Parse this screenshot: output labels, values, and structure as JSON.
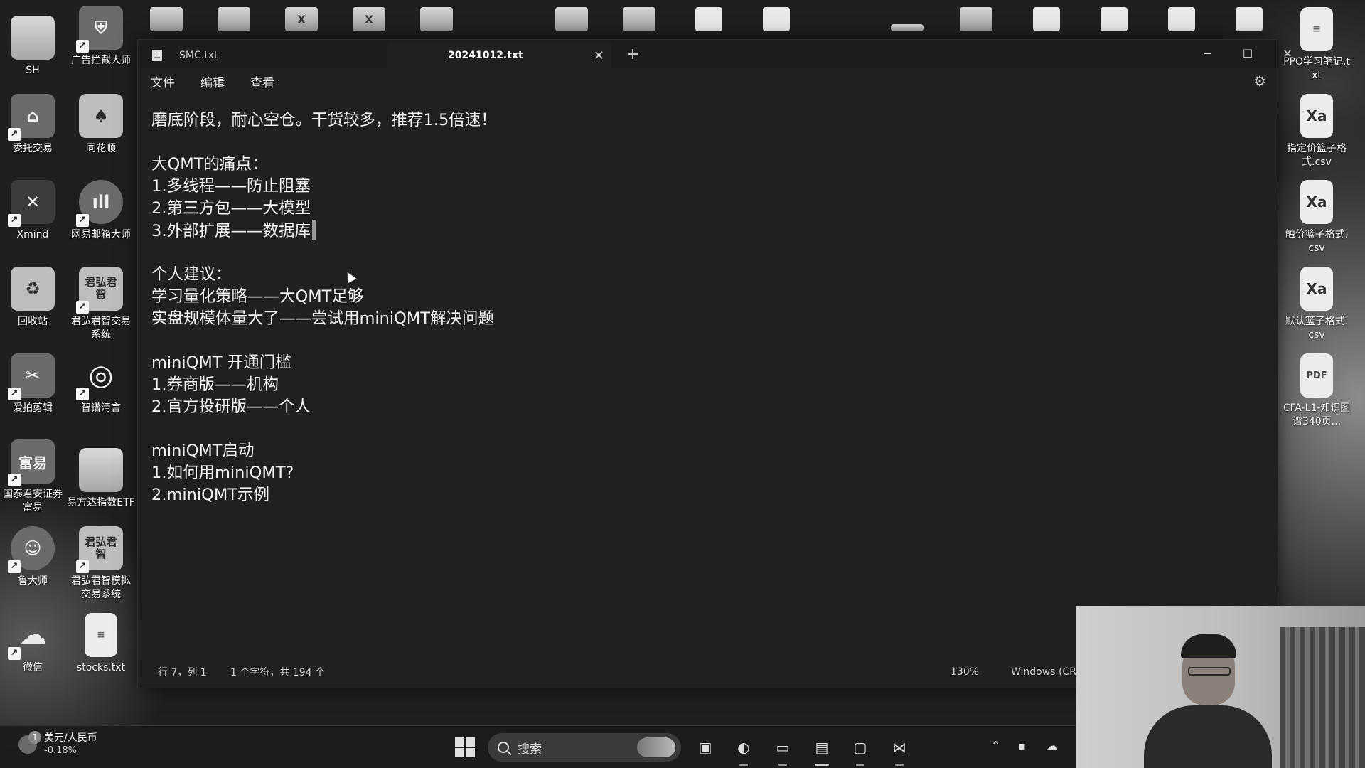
{
  "desktop": {
    "left_icons": [
      {
        "id": "sh",
        "label": "SH",
        "icon": "folder-icon"
      },
      {
        "id": "ad-blocker",
        "label": "广告拦截大师",
        "icon": "shield-icon"
      },
      {
        "id": "trade-delegate",
        "label": "委托交易",
        "icon": "house-icon"
      },
      {
        "id": "tonghuashun",
        "label": "同花顺",
        "icon": "fan-icon"
      },
      {
        "id": "xmind",
        "label": "Xmind",
        "icon": "xmind-icon"
      },
      {
        "id": "netease-mail",
        "label": "网易邮箱大师",
        "icon": "mail-icon"
      },
      {
        "id": "recycle-bin",
        "label": "回收站",
        "icon": "recycle-icon"
      },
      {
        "id": "junhong-trade",
        "label": "君弘君智交易系统",
        "icon": "junhong-icon",
        "glyph_text": "君弘君智"
      },
      {
        "id": "aipai-editor",
        "label": "爱拍剪辑",
        "icon": "scissors-icon"
      },
      {
        "id": "zhipu-qingyan",
        "label": "智谱清言",
        "icon": "spiral-icon"
      },
      {
        "id": "fuyi",
        "label": "国泰君安证券富易",
        "icon": "fuyi-icon",
        "glyph_text": "富易"
      },
      {
        "id": "efund-etf",
        "label": "易方达指数ETF",
        "icon": "folder-icon"
      },
      {
        "id": "ludashi",
        "label": "鲁大师",
        "icon": "ludashi-icon"
      },
      {
        "id": "junhong-sim",
        "label": "君弘君智模拟交易系统",
        "icon": "junhong-icon",
        "glyph_text": "君弘君智"
      },
      {
        "id": "wechat",
        "label": "微信",
        "icon": "wechat-icon"
      },
      {
        "id": "stocks-txt",
        "label": "stocks.txt",
        "icon": "text-file-icon"
      }
    ],
    "right_icons": [
      {
        "id": "ppo-notes",
        "label": "PPO学习笔记.txt",
        "icon": "text-file-icon"
      },
      {
        "id": "limit-basket",
        "label": "指定价篮子格式.csv",
        "icon": "excel-csv-icon"
      },
      {
        "id": "trigger-basket",
        "label": "触价篮子格式.csv",
        "icon": "excel-csv-icon"
      },
      {
        "id": "default-basket",
        "label": "默认篮子格式.csv",
        "icon": "excel-csv-icon"
      },
      {
        "id": "cfa-pdf",
        "label": "CFA-L1-知识图谱340页...",
        "icon": "pdf-icon",
        "glyph_text": "PDF"
      }
    ]
  },
  "notepad": {
    "tabs": [
      {
        "title": "SMC.txt",
        "active": false
      },
      {
        "title": "20241012.txt",
        "active": true
      }
    ],
    "menu": [
      "文件",
      "编辑",
      "查看"
    ],
    "content_lines": [
      "磨底阶段，耐心空仓。干货较多，推荐1.5倍速！",
      "",
      "大QMT的痛点：",
      "1.多线程——防止阻塞",
      "2.第三方包——大模型",
      "3.外部扩展——数据库",
      "",
      "个人建议：",
      "学习量化策略——大QMT足够",
      "实盘规模体量大了——尝试用miniQMT解决问题",
      "",
      "miniQMT 开通门槛",
      "1.券商版——机构",
      "2.官方投研版——个人",
      "",
      "miniQMT启动",
      "1.如何用miniQMT?",
      "2.miniQMT示例"
    ],
    "status": {
      "position": "行 7，列 1",
      "char_count": "1 个字符，共 194 个",
      "zoom": "130%",
      "line_ending": "Windows (CR"
    }
  },
  "taskbar": {
    "widget": {
      "badge": "1",
      "title": "美元/人民币",
      "change": "-0.18%"
    },
    "search_placeholder": "搜索",
    "apps": [
      "file-manager-icon",
      "edge-icon",
      "explorer-icon",
      "notepad-icon",
      "capture-icon",
      "vscode-icon"
    ],
    "tray": [
      "chevron-up-icon",
      "network-icon",
      "onedrive-icon"
    ]
  }
}
